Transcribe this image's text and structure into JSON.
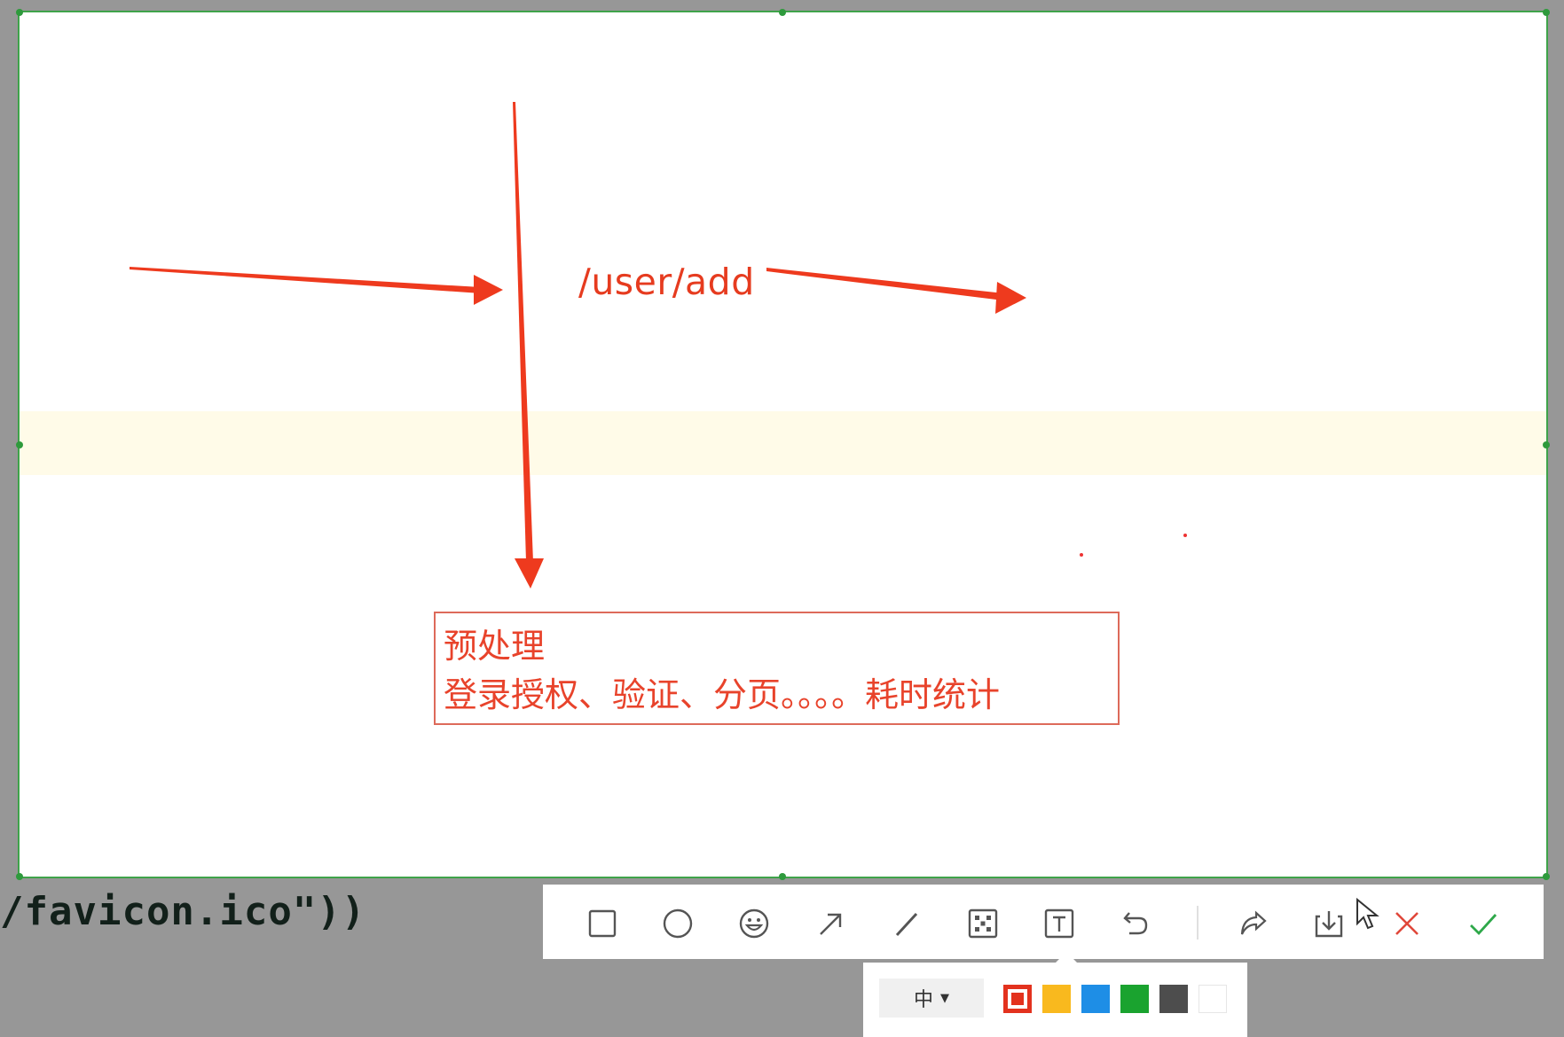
{
  "canvas": {
    "path_label": "/user/add",
    "box_line1": "预处理",
    "box_line2": "登录授权、验证、分页。。。。耗时统计"
  },
  "background_code": {
    "text": "/favicon.ico\"))"
  },
  "toolbar": {
    "tools": [
      {
        "name": "rectangle",
        "icon": "square-icon"
      },
      {
        "name": "ellipse",
        "icon": "circle-icon"
      },
      {
        "name": "emoji",
        "icon": "smiley-icon"
      },
      {
        "name": "arrow",
        "icon": "arrow-icon"
      },
      {
        "name": "line",
        "icon": "pen-line-icon"
      },
      {
        "name": "mosaic",
        "icon": "mosaic-icon"
      },
      {
        "name": "text",
        "icon": "text-icon"
      },
      {
        "name": "undo",
        "icon": "undo-icon"
      },
      {
        "name": "share",
        "icon": "share-icon"
      },
      {
        "name": "save",
        "icon": "download-icon"
      },
      {
        "name": "cancel",
        "icon": "close-icon"
      },
      {
        "name": "confirm",
        "icon": "check-icon"
      }
    ]
  },
  "subpanel": {
    "font_size": "中",
    "colors": [
      "#e3321e",
      "#f9b91e",
      "#1e8ee6",
      "#1aa32f",
      "#4d4d4d",
      "#ffffff"
    ],
    "selected_color": "#e3321e"
  },
  "accent_colors": {
    "annotation": "#ee3a1e",
    "selection_border": "#3fa34a"
  }
}
